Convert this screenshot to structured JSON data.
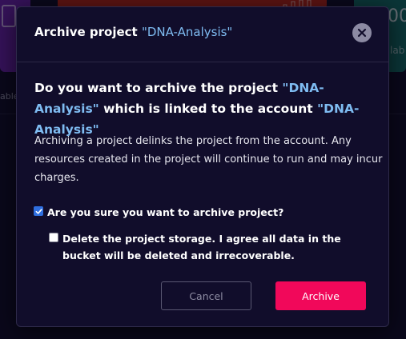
{
  "background": {
    "teal_card_value": "00",
    "teal_card_sub": "lab",
    "left_card_sub": "able"
  },
  "modal": {
    "title_prefix": "Archive project ",
    "title_project": "\"DNA-Analysis\"",
    "question_part1": "Do you want to archive the project ",
    "question_project": "\"DNA-Analysis\"",
    "question_part2": " which is linked to the account ",
    "question_account": "\"DNA-Analysis\"",
    "description": "Archiving a project delinks the project from the account. Any resources created in the project will continue to run and may incur charges.",
    "confirm_label": "Are you sure you want to archive project?",
    "confirm_checked": true,
    "delete_storage_label": "Delete the project storage. I agree all data in the bucket will be deleted and irrecoverable.",
    "delete_storage_checked": false,
    "cancel_label": "Cancel",
    "archive_label": "Archive"
  },
  "colors": {
    "accent": "#f1085a",
    "highlight": "#7fbcf2",
    "modal_bg": "#110d2b",
    "checkbox": "#2f6fe0"
  },
  "icons": {
    "close": "close-icon",
    "check": "check-icon"
  }
}
